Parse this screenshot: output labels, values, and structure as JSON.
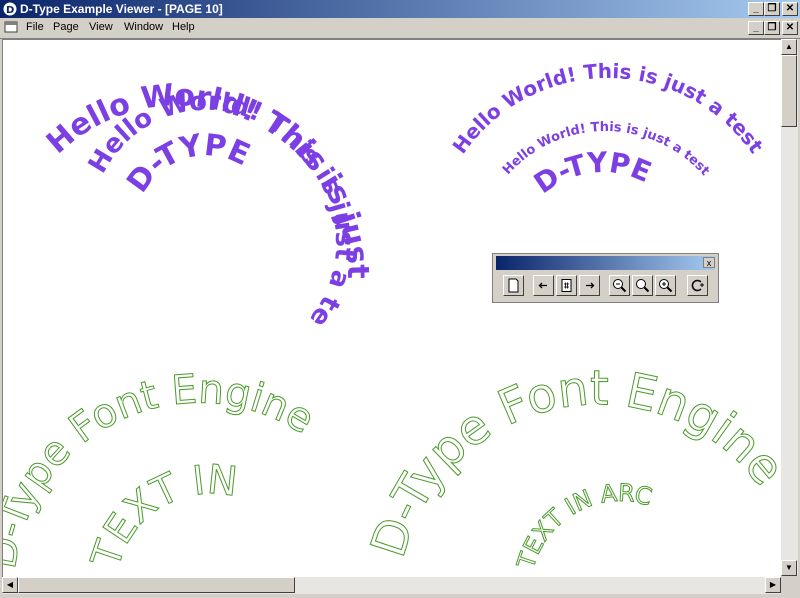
{
  "window": {
    "title": "D-Type Example Viewer - [PAGE 10]",
    "controls": {
      "minimize": "_",
      "restore": "❐",
      "close": "✕"
    }
  },
  "menu": {
    "items": [
      "File",
      "Page",
      "View",
      "Window",
      "Help"
    ]
  },
  "canvas": {
    "purple": {
      "outer_left": "Hello World! This is just a test!",
      "inner_left": "Hello World! This is just a test!",
      "center_left": "D-TYPE",
      "outer_right": "Hello World! This is just a test!",
      "inner_right": "Hello World! This is just a test!",
      "center_right": "D-TYPE",
      "color": "#7b3fe4"
    },
    "green": {
      "arc_left_outer": "D-Type Font Engine",
      "arc_left_inner": "TEXT IN",
      "arc_right_outer": "D-Type Font Engine",
      "arc_right_inner": "TEXT IN ARC",
      "color": "#4a9a2a"
    }
  },
  "toolbar": {
    "buttons": [
      "new-page-icon",
      "prev-page-icon",
      "page-number-icon",
      "next-page-icon",
      "zoom-out-icon",
      "zoom-icon",
      "zoom-in-icon",
      "refresh-icon"
    ],
    "close": "x"
  }
}
